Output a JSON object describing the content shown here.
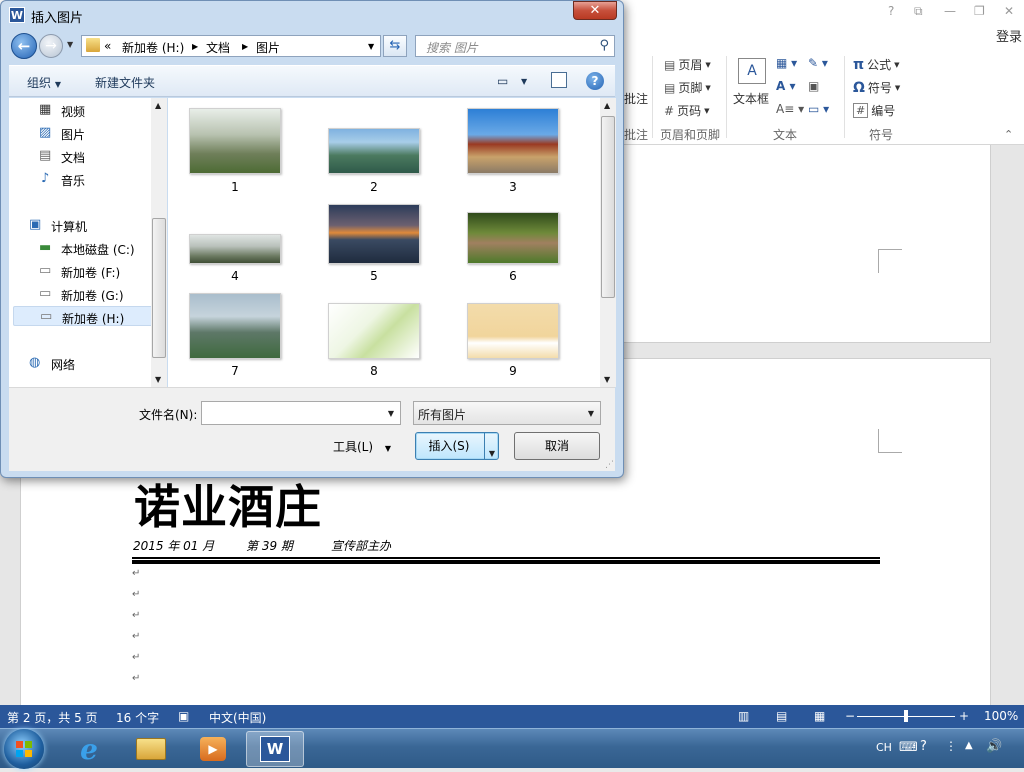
{
  "word": {
    "title_bar_icons": [
      "?",
      "⧉",
      "—",
      "❐",
      "✕"
    ],
    "login": "登录",
    "ribbon": {
      "partial_label_top": "批注",
      "partial_label_group": "批注",
      "header_footer": {
        "header": "页眉",
        "footer": "页脚",
        "page_number": "页码",
        "group": "页眉和页脚"
      },
      "text": {
        "textbox": "文本框",
        "group": "文本"
      },
      "symbols": {
        "equation": "公式",
        "symbol": "符号",
        "numbering": "编号",
        "group": "符号"
      }
    },
    "document": {
      "masthead": "诺业酒庄",
      "date": "2015 年 01 月",
      "issue": "第 39 期",
      "sponsor": "宣传部主办",
      "paragraph_mark": "↵"
    },
    "status": {
      "page": "第 2 页，共 5 页",
      "words": "16 个字",
      "language": "中文(中国)",
      "zoom": "100%",
      "zoom_value": 100
    }
  },
  "taskbar": {
    "tray": {
      "ime": "CH"
    }
  },
  "dialog": {
    "title": "插入图片",
    "close": "✕",
    "breadcrumb": [
      "新加卷 (H:)",
      "文档",
      "图片"
    ],
    "breadcrumb_overflow": "«",
    "search_placeholder": "搜索 图片",
    "organize": "组织",
    "new_folder": "新建文件夹",
    "nav_items": [
      {
        "label": "视频",
        "icon": "video-icon"
      },
      {
        "label": "图片",
        "icon": "pictures-icon"
      },
      {
        "label": "文档",
        "icon": "documents-icon"
      },
      {
        "label": "音乐",
        "icon": "music-icon"
      },
      {
        "label": "计算机",
        "icon": "computer-icon"
      },
      {
        "label": "本地磁盘 (C:)",
        "icon": "local-disk-icon"
      },
      {
        "label": "新加卷 (F:)",
        "icon": "drive-icon"
      },
      {
        "label": "新加卷 (G:)",
        "icon": "drive-icon"
      },
      {
        "label": "新加卷 (H:)",
        "icon": "drive-icon",
        "selected": true
      },
      {
        "label": "网络",
        "icon": "network-icon"
      }
    ],
    "files": [
      {
        "name": "1",
        "bg": "linear-gradient(180deg,#e8eee8 0%,#b8c2b0 40%,#6f7f5a 70%,#4d6b34 100%)"
      },
      {
        "name": "2",
        "bg": "linear-gradient(180deg,#7fb2e0 0%,#a8cde8 30%,#4b7a5f 60%,#2f5a4a 100%)"
      },
      {
        "name": "3",
        "bg": "linear-gradient(180deg,#2d7fd6 0%,#6aa9e6 40%,#9a3a22 55%,#c9a26b 75%,#8a7a66 100%)"
      },
      {
        "name": "4",
        "bg": "linear-gradient(180deg,#dfe4e2 0%,#b9c1bb 40%,#6c7a62 75%,#3f4e35 100%)"
      },
      {
        "name": "5",
        "bg": "linear-gradient(180deg,#2c3c5a 0%,#6c6070 35%,#e08a3a 48%,#3a4a62 60%,#1f2b3e 100%)"
      },
      {
        "name": "6",
        "bg": "linear-gradient(180deg,#2f4a1a 0%,#6f8a3a 40%,#a08060 60%,#4e7a2a 100%)"
      },
      {
        "name": "7",
        "bg": "linear-gradient(180deg,#a9bdcc 0%,#c6d4dc 35%,#5e7868 60%,#3f6a3e 100%)"
      },
      {
        "name": "8",
        "bg": "linear-gradient(135deg,#ffffff 0%,#eef6e4 40%,#c8e0a0 60%,#ffffff 100%)"
      },
      {
        "name": "9",
        "bg": "linear-gradient(180deg,#f3dcab 0%,#f1d59c 60%,#ffffff 72%,#f3dcab 100%)"
      }
    ],
    "filename_label": "文件名(N):",
    "filename_value": "",
    "filter": "所有图片",
    "tools": "工具(L)",
    "insert": "插入(S)",
    "cancel": "取消"
  },
  "colors": {
    "word_blue": "#2b579a",
    "dialog_frame": "#c9dcf0",
    "taskbar": "#3a6796"
  }
}
